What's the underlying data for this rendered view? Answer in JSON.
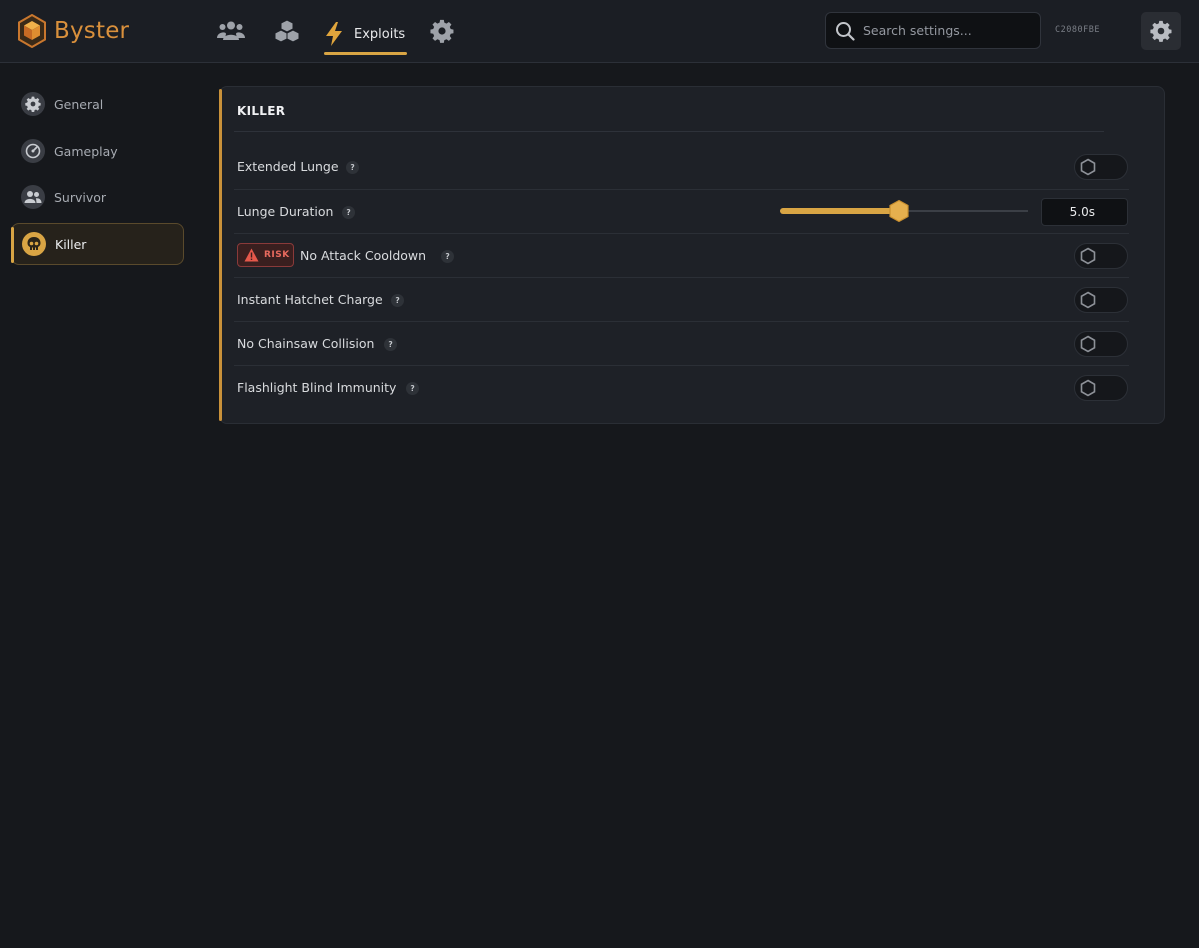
{
  "app": {
    "brand": "Byster",
    "hwid": "C2080FBE"
  },
  "nav": {
    "tabs": [
      {
        "name": "players",
        "icon": "users-icon"
      },
      {
        "name": "modules",
        "icon": "cubes-icon"
      },
      {
        "name": "exploits",
        "icon": "bolt-icon",
        "label": "Exploits",
        "active": true
      },
      {
        "name": "config",
        "icon": "gear-icon"
      }
    ]
  },
  "search": {
    "placeholder": "Search settings..."
  },
  "sidebar": {
    "items": [
      {
        "label": "General",
        "icon": "gear-icon"
      },
      {
        "label": "Gameplay",
        "icon": "gauge-icon"
      },
      {
        "label": "Survivor",
        "icon": "users-icon"
      },
      {
        "label": "Killer",
        "icon": "skull-icon",
        "active": true
      }
    ]
  },
  "section": {
    "title": "KILLER",
    "settings": [
      {
        "label": "Extended Lunge",
        "type": "toggle",
        "enabled": false
      },
      {
        "label": "Lunge Duration",
        "type": "slider",
        "value": "5.0s",
        "fraction": 0.48
      },
      {
        "label": "No Attack Cooldown",
        "type": "toggle",
        "enabled": false,
        "badge": "RISK"
      },
      {
        "label": "Instant Hatchet Charge",
        "type": "toggle",
        "enabled": false
      },
      {
        "label": "No Chainsaw Collision",
        "type": "toggle",
        "enabled": false
      },
      {
        "label": "Flashlight Blind Immunity",
        "type": "toggle",
        "enabled": false
      }
    ],
    "help_glyph": "?"
  },
  "colors": {
    "accent": "#d9a544",
    "brand": "#d9903c",
    "risk": "#e86a5e"
  }
}
